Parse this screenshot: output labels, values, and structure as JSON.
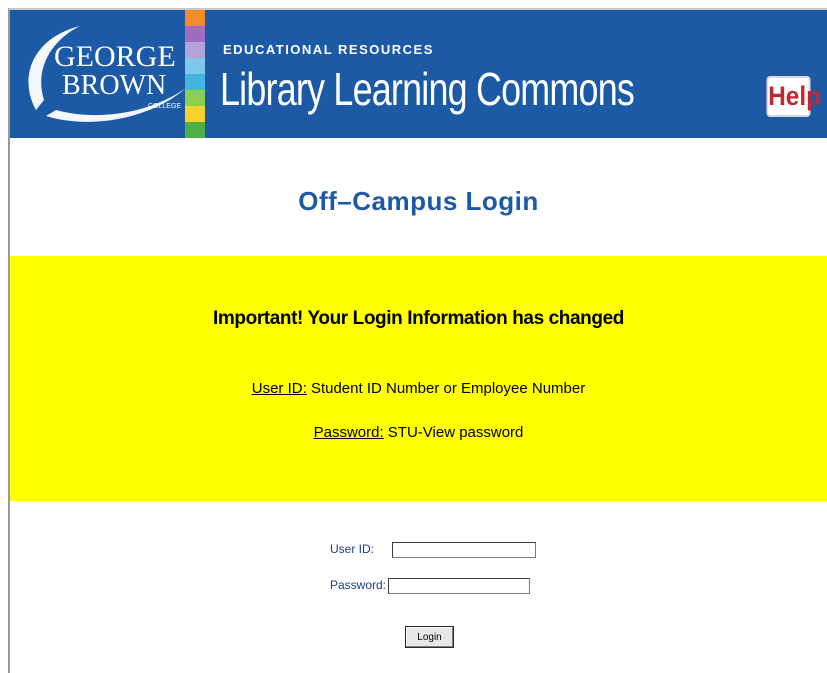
{
  "banner": {
    "logo_line1": "GEORGE",
    "logo_line2": "BROWN",
    "logo_sub": "COLLEGE",
    "tagline": "EDUCATIONAL RESOURCES",
    "title": "Library Learning Commons",
    "help_label": "Help",
    "colors": {
      "banner": "#1c5aa6",
      "bars": [
        "#f28c28",
        "#a06cc0",
        "#b3a3d8",
        "#7ec8ea",
        "#46b4e0",
        "#8ccf4f",
        "#f4d32a",
        "#4faf47"
      ]
    }
  },
  "page_title": "Off–Campus Login",
  "notice": {
    "heading": "Important! Your Login Information has changed",
    "user_id_label": "User ID:",
    "user_id_text": "Student ID Number or Employee Number",
    "password_label": "Password:",
    "password_text": "STU-View password",
    "color": "#ffff00"
  },
  "form": {
    "user_id_label": "User ID:",
    "user_id_value": "",
    "password_label": "Password:",
    "password_value": "",
    "login_button": "Login"
  }
}
